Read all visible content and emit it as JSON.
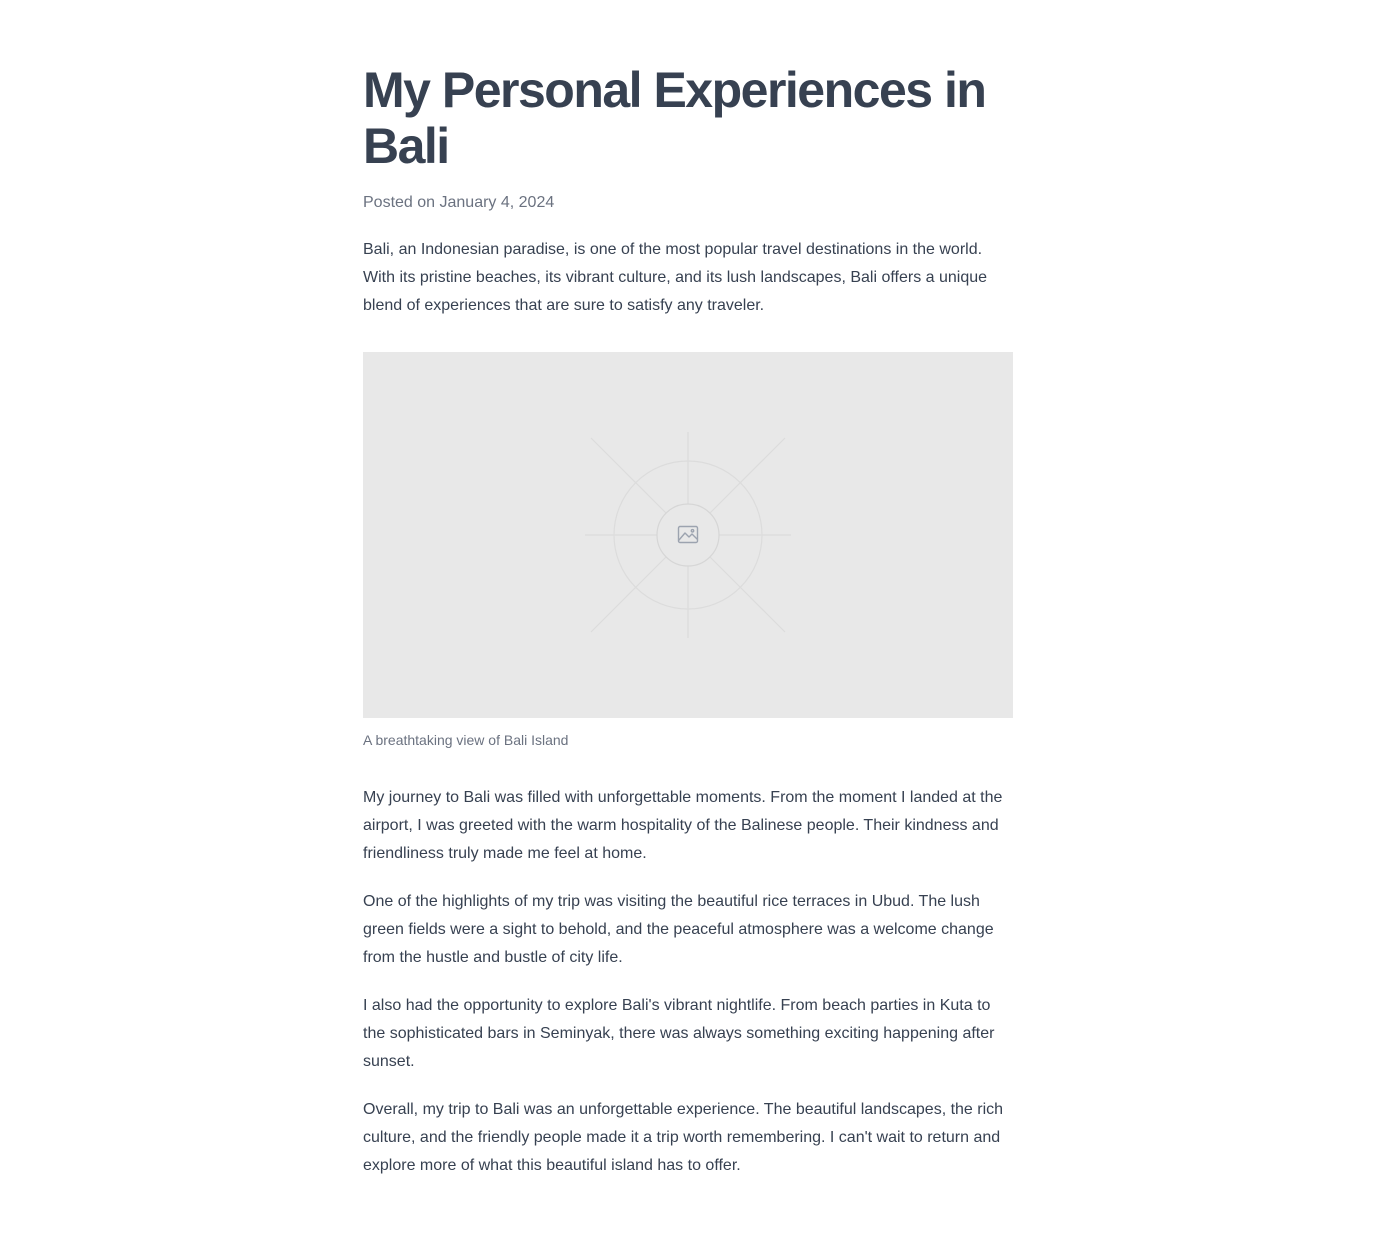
{
  "article": {
    "title": "My Personal Experiences in Bali",
    "posted": "Posted on January 4, 2024",
    "intro": "Bali, an Indonesian paradise, is one of the most popular travel destinations in the world. With its pristine beaches, its vibrant culture, and its lush landscapes, Bali offers a unique blend of experiences that are sure to satisfy any traveler.",
    "figure": {
      "icon": "image-icon",
      "caption": "A breathtaking view of Bali Island"
    },
    "paragraphs": [
      "My journey to Bali was filled with unforgettable moments. From the moment I landed at the airport, I was greeted with the warm hospitality of the Balinese people. Their kindness and friendliness truly made me feel at home.",
      "One of the highlights of my trip was visiting the beautiful rice terraces in Ubud. The lush green fields were a sight to behold, and the peaceful atmosphere was a welcome change from the hustle and bustle of city life.",
      "I also had the opportunity to explore Bali's vibrant nightlife. From beach parties in Kuta to the sophisticated bars in Seminyak, there was always something exciting happening after sunset.",
      "Overall, my trip to Bali was an unforgettable experience. The beautiful landscapes, the rich culture, and the friendly people made it a trip worth remembering. I can't wait to return and explore more of what this beautiful island has to offer."
    ]
  },
  "colors": {
    "text": "#374151",
    "muted": "#6b7280",
    "placeholder_bg": "#e8e8e8"
  }
}
